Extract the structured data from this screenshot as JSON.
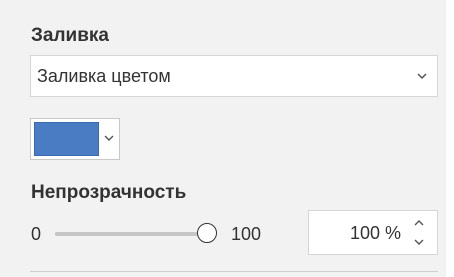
{
  "fill_section": {
    "title": "Заливка",
    "fill_type": {
      "selected": "Заливка цветом",
      "chevron_icon": "chevron-down-icon"
    },
    "color": {
      "value": "#4a7cc4",
      "chevron_icon": "chevron-down-icon"
    }
  },
  "opacity_section": {
    "title": "Непрозрачность",
    "slider": {
      "min_label": "0",
      "max_label": "100",
      "min": 0,
      "max": 100,
      "value": 100
    },
    "spinner": {
      "value": "100 %",
      "up_icon": "chevron-up-icon",
      "down_icon": "chevron-down-icon"
    }
  }
}
